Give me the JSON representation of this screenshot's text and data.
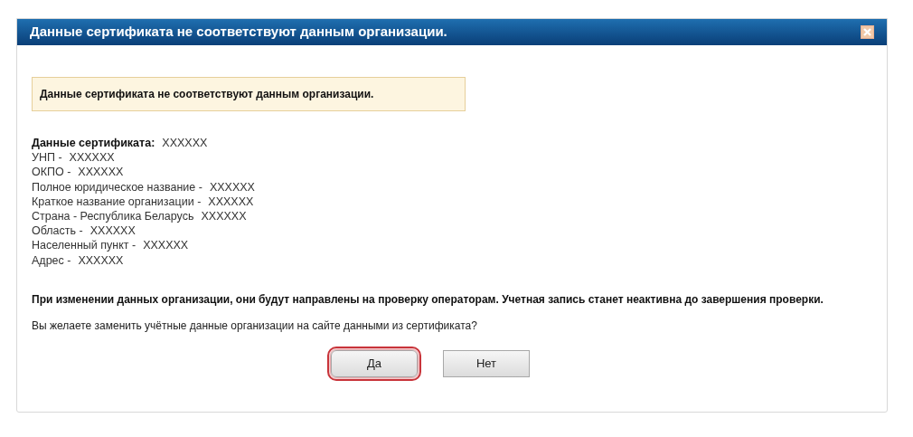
{
  "dialog": {
    "title": "Данные сертификата не соответствуют данным организации.",
    "alert": "Данные сертификата не соответствуют данным организации.",
    "details": [
      {
        "kind": "heading",
        "label": "Данные сертификата:",
        "value": "XXXXXX"
      },
      {
        "kind": "line",
        "label": "УНП -",
        "value": "XXXXXX"
      },
      {
        "kind": "line",
        "label": "ОКПО -",
        "value": "XXXXXX"
      },
      {
        "kind": "line",
        "label": "Полное юридическое название -",
        "value": "XXXXXX"
      },
      {
        "kind": "line",
        "label": "Краткое название организации -",
        "value": "XXXXXX"
      },
      {
        "kind": "line",
        "label": "Страна - Республика Беларусь",
        "value": "XXXXXX"
      },
      {
        "kind": "line",
        "label": "Область -",
        "value": "XXXXXX"
      },
      {
        "kind": "line",
        "label": "Населенный пункт -",
        "value": "XXXXXX"
      },
      {
        "kind": "line",
        "label": "Адрес -",
        "value": "XXXXXX"
      }
    ],
    "warning": "При изменении данных организации, они будут направлены на проверку операторам. Учетная запись станет неактивна до завершения проверки.",
    "question": "Вы желаете заменить учётные данные организации на сайте данными из сертификата?",
    "buttons": [
      {
        "label": "Да",
        "highlighted": true
      },
      {
        "label": "Нет",
        "highlighted": false
      }
    ]
  }
}
